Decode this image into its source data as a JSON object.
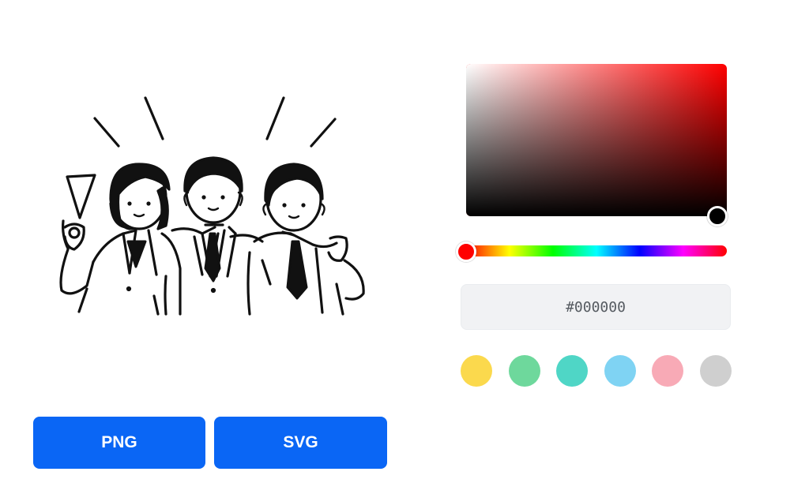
{
  "export": {
    "png_label": "PNG",
    "svg_label": "SVG",
    "button_color": "#0a66f5"
  },
  "picker": {
    "hue_color": "#ff0000",
    "hex_value": "#000000",
    "selected_color": "#000000",
    "hue": 0,
    "saturation": 1,
    "value": 0,
    "swatches": [
      {
        "name": "yellow",
        "color": "#fbd94d"
      },
      {
        "name": "green",
        "color": "#6ed89c"
      },
      {
        "name": "teal",
        "color": "#4fd6c6"
      },
      {
        "name": "sky-blue",
        "color": "#7fd3f3"
      },
      {
        "name": "pink",
        "color": "#f8aab6"
      },
      {
        "name": "gray",
        "color": "#cfcfcf"
      }
    ]
  },
  "illustration": {
    "subject": "three-cheering-office-workers-icon",
    "stroke_color": "#111111"
  }
}
